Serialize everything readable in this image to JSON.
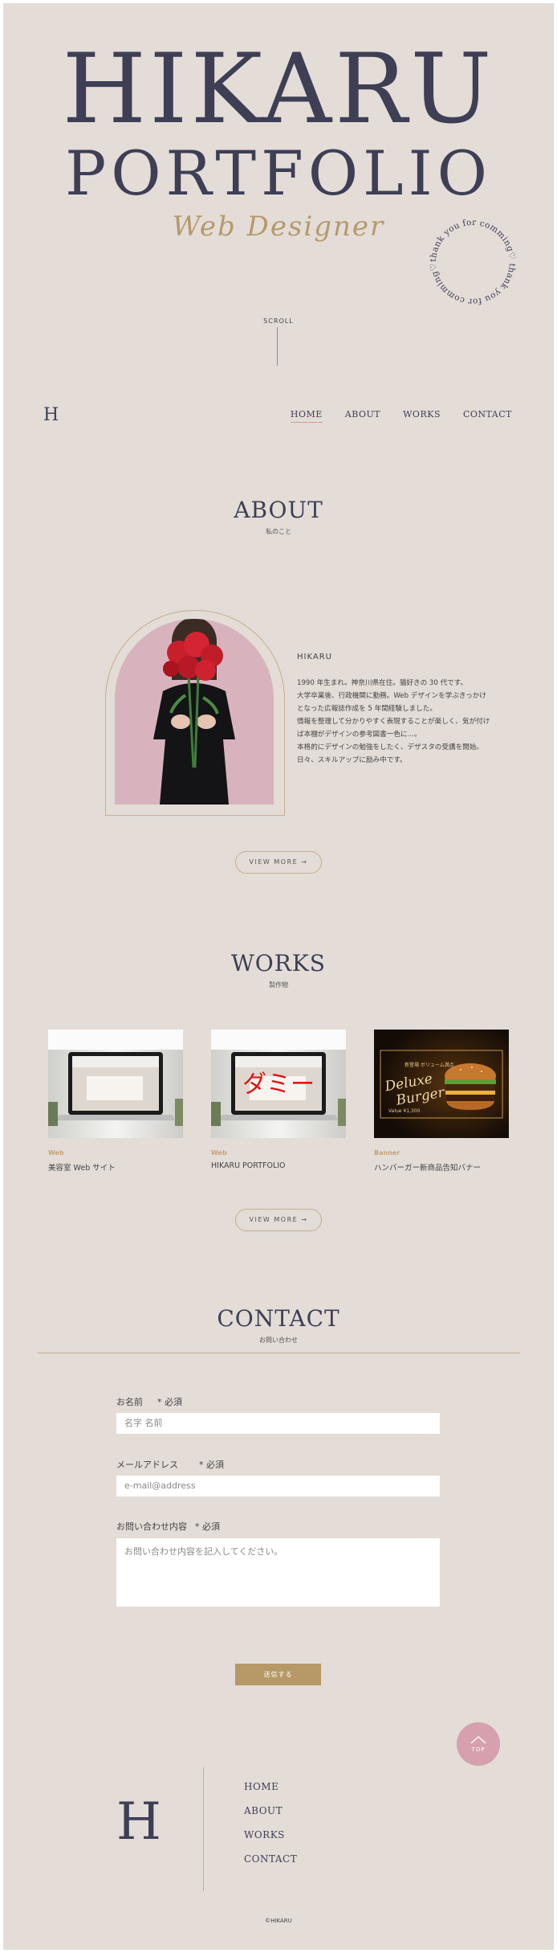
{
  "hero": {
    "title_line1": "HIKARU",
    "title_line2": "PORTFOLIO",
    "script": "Web Designer",
    "circle_text": "thank you for comming♡ thank you for comming♡",
    "scroll_label": "SCROLL"
  },
  "nav": {
    "logo": "H",
    "items": [
      "HOME",
      "ABOUT",
      "WORKS",
      "CONTACT"
    ],
    "active": "HOME"
  },
  "about": {
    "title": "ABOUT",
    "subtitle": "私のこと",
    "name": "HIKARU",
    "lines": [
      "1990 年生まれ。神奈川県在住。猫好きの 30 代です。",
      "大学卒業後、行政機関に勤務。Web デザインを学ぶきっかけ",
      "となった広報誌作成を 5 年間経験しました。",
      "情報を整理して分かりやすく表現することが楽しく、気が付け",
      "ば本棚がデザインの参考図書一色に…。",
      "本格的にデザインの勉強をしたく、デザスタの受講を開始。",
      "日々、スキルアップに励み中です。"
    ],
    "view_more": "VIEW MORE  →"
  },
  "works": {
    "title": "WORKS",
    "subtitle": "製作物",
    "items": [
      {
        "category": "Web",
        "title": "美容室 Web サイト"
      },
      {
        "category": "Web",
        "title": "HIKARU  PORTFOLIO",
        "overlay": "ダミー"
      },
      {
        "category": "Banner",
        "title": "ハンバーガー新商品告知バナー",
        "banner_title_1": "Deluxe",
        "banner_title_2": "Burger",
        "banner_top": "新登場 ボリューム満点",
        "banner_price": "Value ¥1,300"
      }
    ],
    "view_more": "VIEW MORE  →"
  },
  "contact": {
    "title": "CONTACT",
    "subtitle": "お問い合わせ",
    "name_label": "お名前",
    "email_label": "メールアドレス",
    "message_label": "お問い合わせ内容",
    "required": "* 必須",
    "name_placeholder": "名字 名前",
    "email_placeholder": "e-mail@address",
    "message_placeholder": "お問い合わせ内容を記入してください。",
    "submit": "送信する",
    "top_label": "TOP"
  },
  "footer": {
    "logo": "H",
    "nav": [
      "HOME",
      "ABOUT",
      "WORKS",
      "CONTACT"
    ],
    "copyright": "©HIKARU"
  },
  "colors": {
    "background": "#e3dcd7",
    "navy": "#3e3f55",
    "gold": "#b69966",
    "pink": "#d7a0ae"
  }
}
